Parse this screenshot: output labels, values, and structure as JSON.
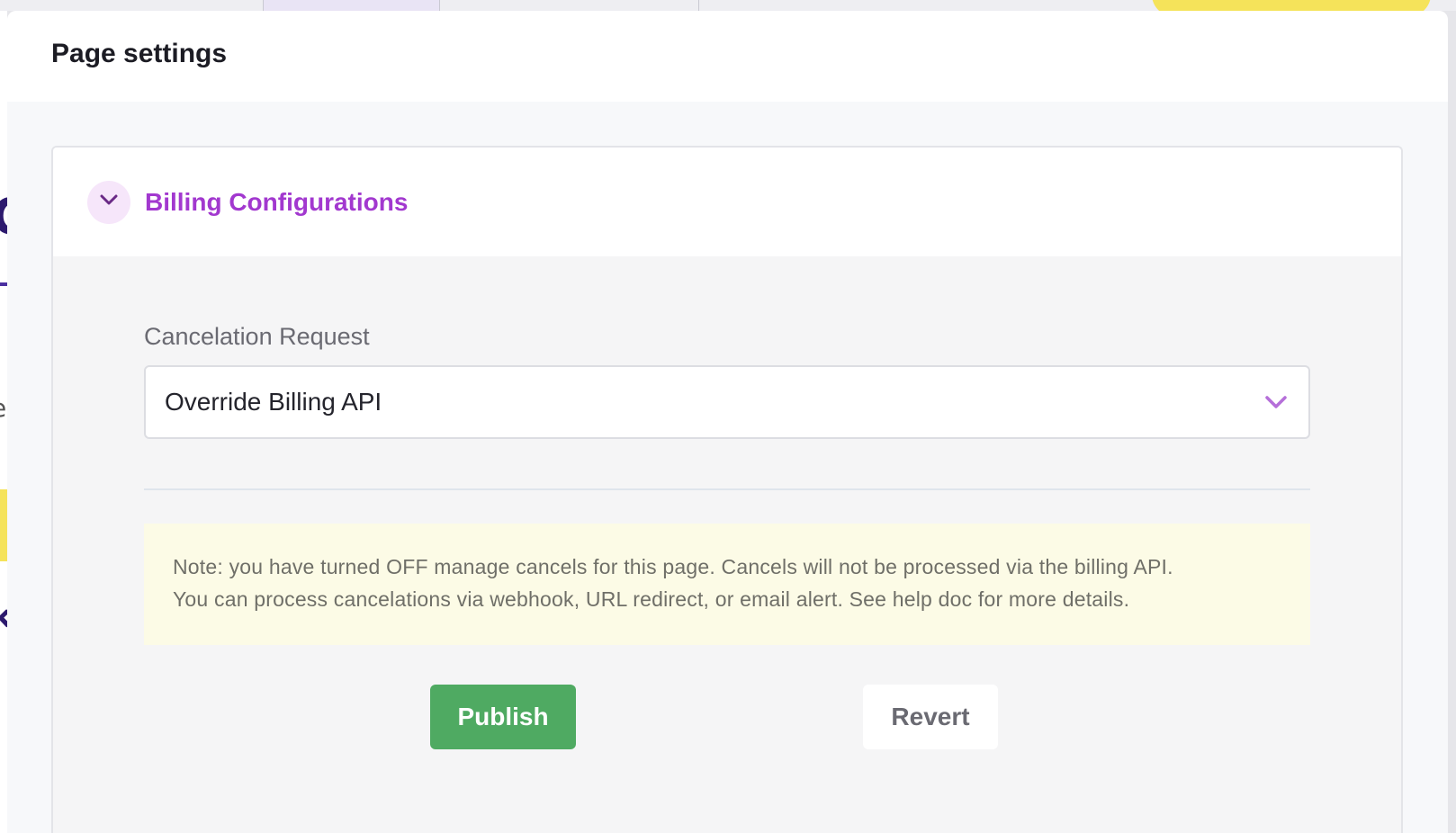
{
  "modal": {
    "title": "Page settings"
  },
  "section": {
    "title": "Billing Configurations",
    "toggle_icon": "chevron-down-icon",
    "accent_color": "#a238cf"
  },
  "cancelation_request": {
    "label": "Cancelation Request",
    "selected_value": "Override Billing API",
    "dropdown_icon": "chevron-down-icon"
  },
  "note": {
    "line1": "Note: you have turned OFF manage cancels for this page. Cancels will not be processed via the billing API.",
    "line2": "You can process cancelations via webhook, URL redirect, or email alert. See help doc for more details."
  },
  "actions": {
    "publish_label": "Publish",
    "revert_label": "Revert",
    "publish_color": "#4faa62"
  }
}
